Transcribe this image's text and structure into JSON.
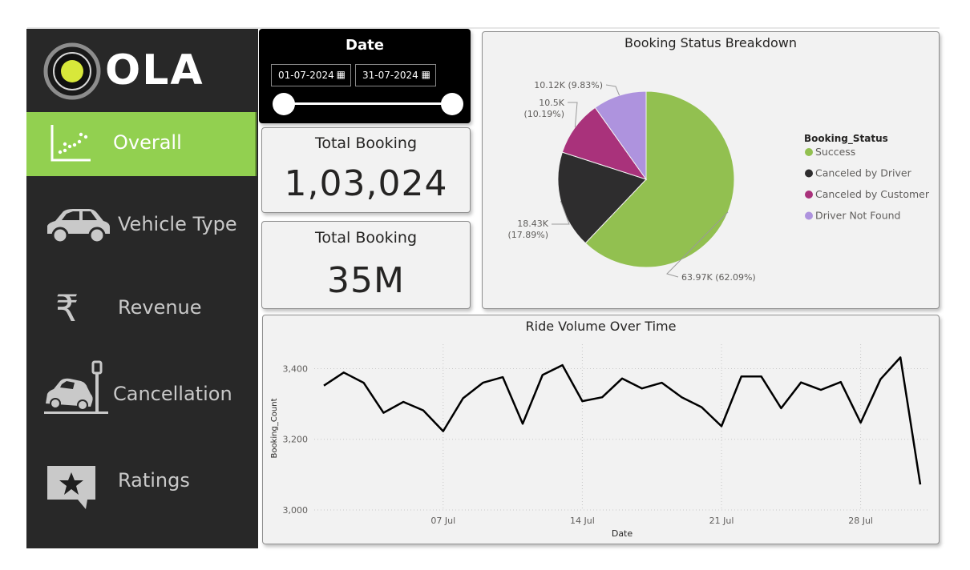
{
  "brand": {
    "name": "OLA"
  },
  "nav": {
    "items": [
      {
        "label": "Overall",
        "icon": "scatter-chart-icon",
        "active": true
      },
      {
        "label": "Vehicle Type",
        "icon": "car-icon",
        "active": false
      },
      {
        "label": "Revenue",
        "icon": "rupee-icon",
        "active": false
      },
      {
        "label": "Cancellation",
        "icon": "car-crash-icon",
        "active": false
      },
      {
        "label": "Ratings",
        "icon": "star-comment-icon",
        "active": false
      }
    ]
  },
  "date_filter": {
    "title": "Date",
    "start": "01-07-2024",
    "end": "31-07-2024"
  },
  "kpis": [
    {
      "title": "Total Booking",
      "value": "1,03,024"
    },
    {
      "title": "Total Booking",
      "value": "35M"
    }
  ],
  "colors": {
    "success": "#92c050",
    "canceled_driver": "#2e2d2e",
    "canceled_customer": "#a9327b",
    "driver_not_found": "#ae93de",
    "active_nav": "#92d050"
  },
  "chart_data": [
    {
      "type": "pie",
      "title": "Booking Status Breakdown",
      "legend_title": "Booking_Status",
      "legend_position": "right",
      "slices": [
        {
          "name": "Success",
          "value": 63970,
          "label": "63.97K (62.09%)"
        },
        {
          "name": "Canceled by Driver",
          "value": 18430,
          "label": "18.43K (17.89%)"
        },
        {
          "name": "Canceled by Customer",
          "value": 10500,
          "label": "10.5K (10.19%)"
        },
        {
          "name": "Driver Not Found",
          "value": 10120,
          "label": "10.12K (9.83%)"
        }
      ]
    },
    {
      "type": "line",
      "title": "Ride Volume Over Time",
      "xlabel": "Date",
      "ylabel": "Booking_Count",
      "ylim": [
        3000,
        3460
      ],
      "yticks": [
        "3,000",
        "3,200",
        "3,400"
      ],
      "xticks": [
        "07 Jul",
        "14 Jul",
        "21 Jul",
        "28 Jul"
      ],
      "grid": true,
      "x": [
        1,
        2,
        3,
        4,
        5,
        6,
        7,
        8,
        9,
        10,
        11,
        12,
        13,
        14,
        15,
        16,
        17,
        18,
        19,
        20,
        21,
        22,
        23,
        24,
        25,
        26,
        27,
        28,
        29,
        30,
        31
      ],
      "values": [
        3352,
        3389,
        3360,
        3275,
        3306,
        3282,
        3223,
        3316,
        3360,
        3376,
        3244,
        3382,
        3410,
        3308,
        3319,
        3372,
        3344,
        3360,
        3319,
        3291,
        3237,
        3378,
        3378,
        3288,
        3361,
        3340,
        3362,
        3247,
        3370,
        3432,
        3072
      ]
    }
  ]
}
